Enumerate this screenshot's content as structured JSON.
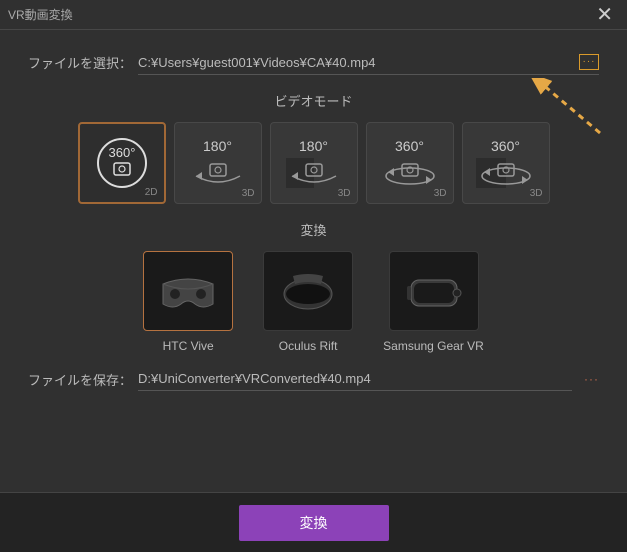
{
  "window": {
    "title": "VR動画変換"
  },
  "file_select": {
    "label": "ファイルを選択：",
    "path": "C:¥Users¥guest001¥Videos¥CA¥40.mp4"
  },
  "video_mode": {
    "title": "ビデオモード",
    "modes": [
      {
        "degree": "360°",
        "badge": "2D"
      },
      {
        "degree": "180°",
        "badge": "3D"
      },
      {
        "degree": "180°",
        "badge": "3D"
      },
      {
        "degree": "360°",
        "badge": "3D"
      },
      {
        "degree": "360°",
        "badge": "3D"
      }
    ]
  },
  "convert": {
    "title": "変換",
    "devices": [
      {
        "name": "HTC Vive"
      },
      {
        "name": "Oculus Rift"
      },
      {
        "name": "Samsung Gear VR"
      }
    ]
  },
  "file_save": {
    "label": "ファイルを保存：",
    "path": "D:¥UniConverter¥VRConverted¥40.mp4"
  },
  "footer": {
    "convert_label": "変換"
  }
}
